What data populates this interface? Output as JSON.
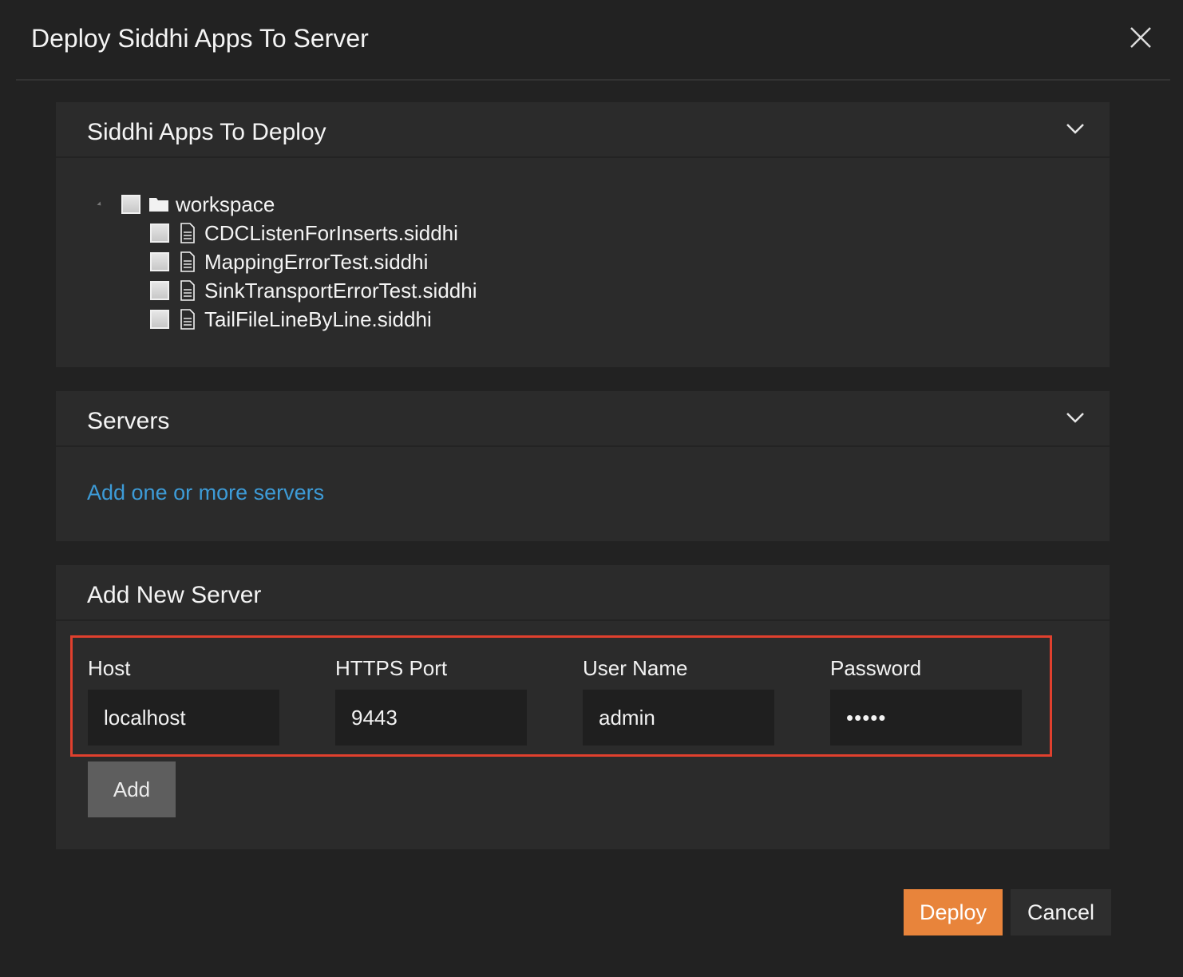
{
  "dialog": {
    "title": "Deploy Siddhi Apps To Server"
  },
  "apps_panel": {
    "title": "Siddhi Apps To Deploy",
    "tree": {
      "folder": "workspace",
      "files": [
        "CDCListenForInserts.siddhi",
        "MappingErrorTest.siddhi",
        "SinkTransportErrorTest.siddhi",
        "TailFileLineByLine.siddhi"
      ]
    }
  },
  "servers_panel": {
    "title": "Servers",
    "add_link": "Add one or more servers"
  },
  "new_server_panel": {
    "title": "Add New Server",
    "host_label": "Host",
    "host_value": "localhost",
    "port_label": "HTTPS Port",
    "port_value": "9443",
    "username_label": "User Name",
    "username_value": "admin",
    "password_label": "Password",
    "password_value": "•••••",
    "add_label": "Add"
  },
  "footer": {
    "deploy_label": "Deploy",
    "cancel_label": "Cancel"
  },
  "colors": {
    "accent": "#e8843b",
    "link": "#3d9bd7",
    "highlight": "#e0402e"
  }
}
